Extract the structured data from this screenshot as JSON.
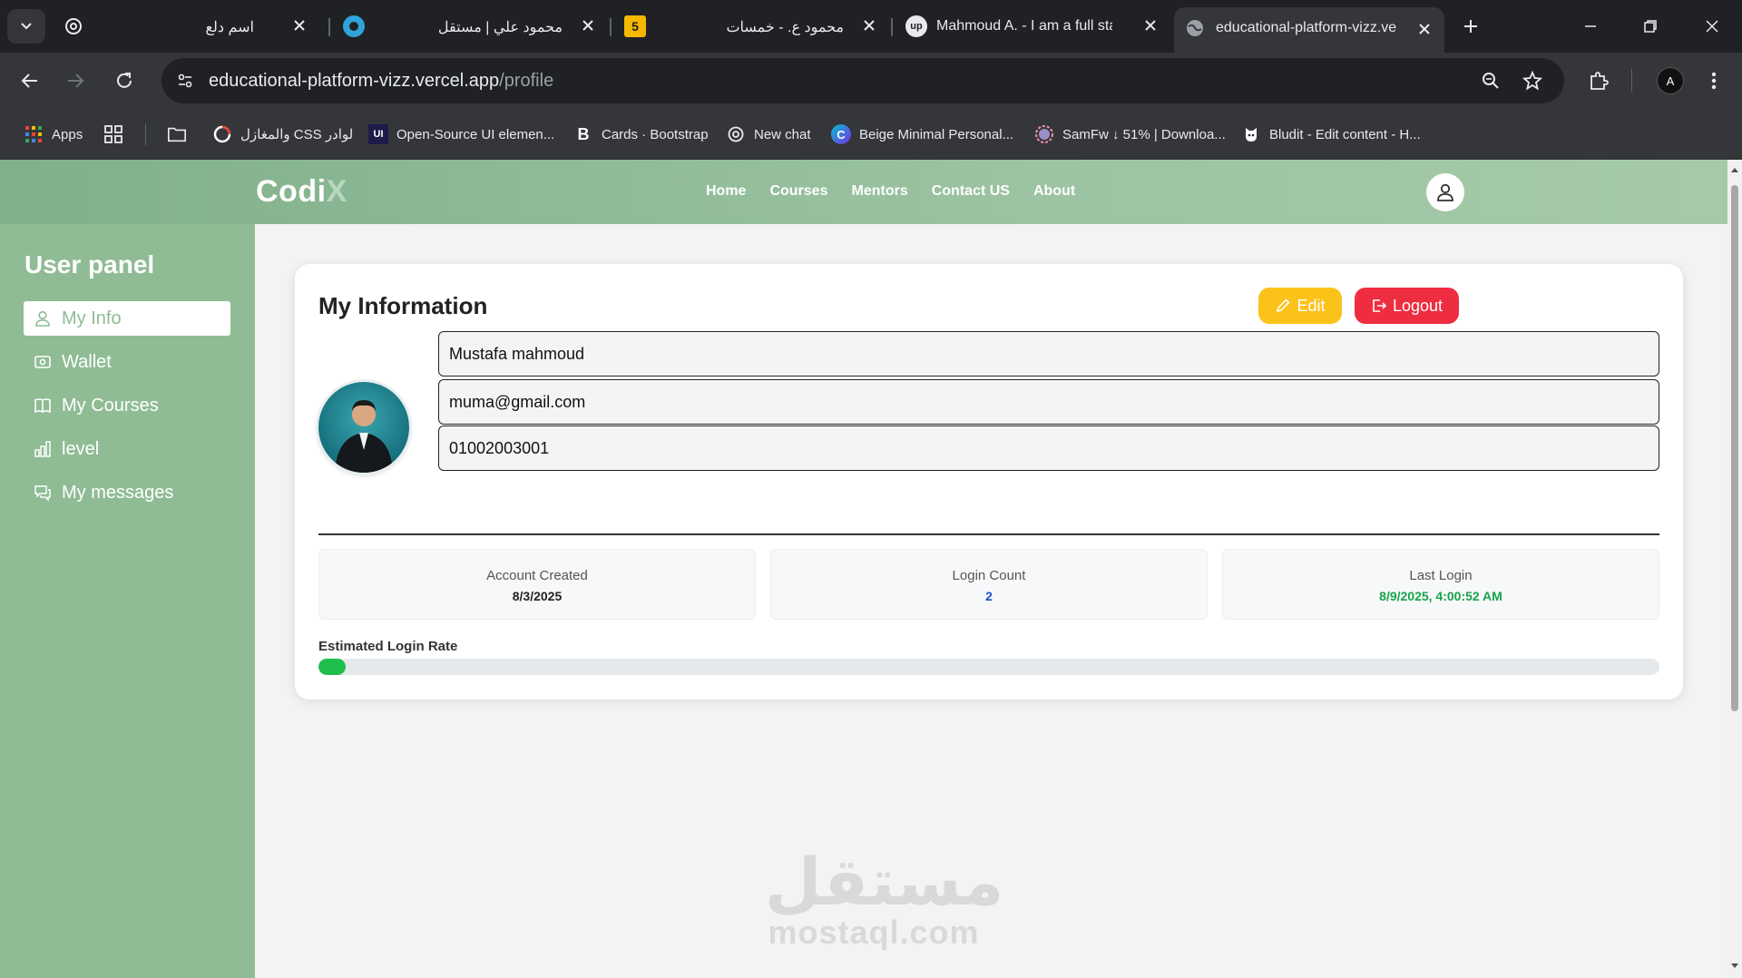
{
  "browser": {
    "tabs": [
      {
        "title": "اسم دلع",
        "favicon": "chatgpt-icon"
      },
      {
        "title": "محمود علي | مستقل",
        "favicon": "mostaql-icon"
      },
      {
        "title": "محمود ع. - خمسات",
        "favicon": "khamsat-icon"
      },
      {
        "title": "Mahmoud A. - I am a full stack",
        "favicon": "upwork-icon"
      },
      {
        "title": "educational-platform-vizz.verce",
        "favicon": "globe-icon"
      }
    ],
    "url_host": "educational-platform-vizz.vercel.app",
    "url_path": "/profile",
    "profile_initials": "A",
    "bookmarks": [
      {
        "label": "Apps",
        "icon": "apps-grid-icon"
      },
      {
        "label": "",
        "icon": "tab-groups-icon"
      },
      {
        "label": "",
        "icon": "folder-icon"
      },
      {
        "label": "لوادر CSS والمغازل",
        "icon": "loader-icon"
      },
      {
        "label": "Open-Source UI elemen...",
        "icon": "uiverse-icon"
      },
      {
        "label": "Cards · Bootstrap",
        "icon": "bootstrap-icon"
      },
      {
        "label": "New chat",
        "icon": "chatgpt-icon"
      },
      {
        "label": "Beige Minimal Personal...",
        "icon": "canva-icon"
      },
      {
        "label": "SamFw ↓ 51% | Downloa...",
        "icon": "samfw-icon"
      },
      {
        "label": "Bludit - Edit content - H...",
        "icon": "bludit-icon"
      }
    ]
  },
  "site": {
    "logo_main": "Codi",
    "logo_accent": "X",
    "nav": [
      "Home",
      "Courses",
      "Mentors",
      "Contact US",
      "About"
    ]
  },
  "sidebar": {
    "title": "User panel",
    "items": [
      {
        "label": "My Info",
        "icon": "user-icon",
        "active": true
      },
      {
        "label": "Wallet",
        "icon": "wallet-icon",
        "active": false
      },
      {
        "label": "My Courses",
        "icon": "book-icon",
        "active": false
      },
      {
        "label": "level",
        "icon": "bar-chart-icon",
        "active": false
      },
      {
        "label": "My messages",
        "icon": "messages-icon",
        "active": false
      }
    ]
  },
  "profile": {
    "title": "My Information",
    "edit_label": "Edit",
    "logout_label": "Logout",
    "name": "Mustafa mahmoud",
    "email": "muma@gmail.com",
    "phone": "01002003001",
    "stats": [
      {
        "label": "Account Created",
        "value": "8/3/2025",
        "color": "#222222"
      },
      {
        "label": "Login Count",
        "value": "2",
        "color": "#1d4ed8"
      },
      {
        "label": "Last Login",
        "value": "8/9/2025, 4:00:52 AM",
        "color": "#16a34a"
      }
    ],
    "rate_label": "Estimated Login Rate",
    "rate_fraction": 0.02
  },
  "watermark": {
    "arabic": "مستقل",
    "latin": "mostaql.com"
  },
  "colors": {
    "accent_green": "#8fbc94",
    "edit_yellow": "#fbc21a",
    "logout_red": "#ef2d41",
    "progress_green": "#1fbf4e"
  }
}
